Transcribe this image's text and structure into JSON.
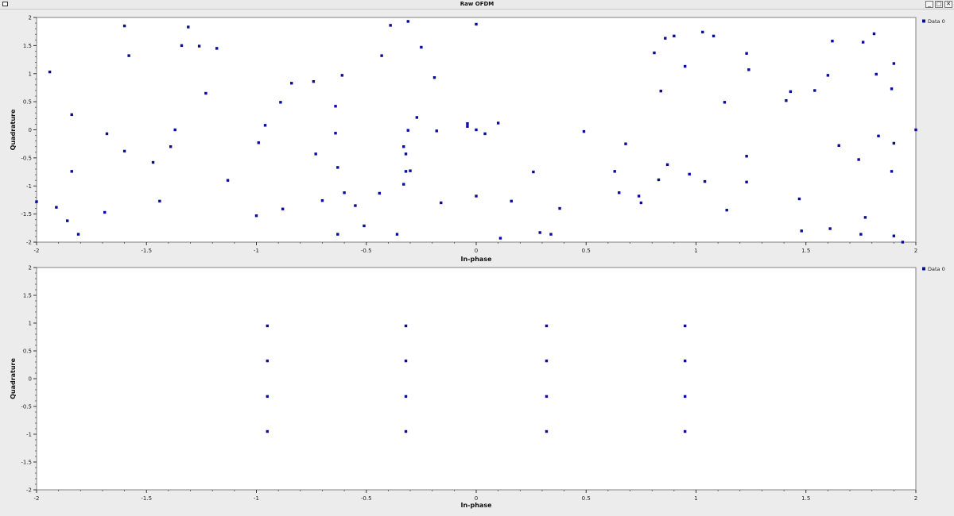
{
  "window": {
    "title": "Raw OFDM",
    "buttons": [
      {
        "name": "minimize-button",
        "glyph": "_"
      },
      {
        "name": "maximize-button",
        "glyph": "□"
      },
      {
        "name": "close-button",
        "glyph": "✕"
      }
    ]
  },
  "colors": {
    "marker": "#0a0a9c",
    "plot_bg": "#ffffff",
    "frame": "#808080"
  },
  "chart_data": [
    {
      "type": "scatter",
      "xlabel": "In-phase",
      "ylabel": "Quadrature",
      "xlim": [
        -2,
        2
      ],
      "ylim": [
        -2,
        2
      ],
      "xticks": [
        "-2",
        "-1.5",
        "-1",
        "-0.5",
        "0",
        "0.5",
        "1",
        "1.5",
        "2"
      ],
      "yticks": [
        "2",
        "1.5",
        "1",
        "0.5",
        "0",
        "-0.5",
        "-1",
        "-1.5",
        "-2"
      ],
      "grid": false,
      "legend": "top-right",
      "series": [
        {
          "name": "Data 0",
          "points": [
            [
              -2.0,
              -1.28
            ],
            [
              -1.94,
              1.03
            ],
            [
              -1.91,
              -1.38
            ],
            [
              -1.86,
              -1.62
            ],
            [
              -1.84,
              0.27
            ],
            [
              -1.84,
              -0.74
            ],
            [
              -1.81,
              -1.86
            ],
            [
              -1.69,
              -1.47
            ],
            [
              -1.68,
              -0.07
            ],
            [
              -1.6,
              1.85
            ],
            [
              -1.6,
              -0.38
            ],
            [
              -1.58,
              1.32
            ],
            [
              -1.47,
              -0.58
            ],
            [
              -1.44,
              -1.27
            ],
            [
              -1.39,
              -0.3
            ],
            [
              -1.37,
              0.0
            ],
            [
              -1.34,
              1.5
            ],
            [
              -1.31,
              1.83
            ],
            [
              -1.26,
              1.49
            ],
            [
              -1.23,
              0.65
            ],
            [
              -1.18,
              1.45
            ],
            [
              -1.13,
              -0.9
            ],
            [
              -1.0,
              -1.53
            ],
            [
              -0.99,
              -0.23
            ],
            [
              -0.96,
              0.08
            ],
            [
              -0.89,
              0.49
            ],
            [
              -0.88,
              -1.41
            ],
            [
              -0.84,
              0.83
            ],
            [
              -0.74,
              0.86
            ],
            [
              -0.73,
              -0.43
            ],
            [
              -0.7,
              -1.26
            ],
            [
              -0.64,
              0.42
            ],
            [
              -0.64,
              -0.06
            ],
            [
              -0.63,
              -0.67
            ],
            [
              -0.63,
              -1.86
            ],
            [
              -0.61,
              0.97
            ],
            [
              -0.6,
              -1.12
            ],
            [
              -0.55,
              -1.35
            ],
            [
              -0.51,
              -1.71
            ],
            [
              -0.44,
              -1.13
            ],
            [
              -0.43,
              1.32
            ],
            [
              -0.39,
              1.86
            ],
            [
              -0.36,
              -1.86
            ],
            [
              -0.33,
              -0.97
            ],
            [
              -0.33,
              -0.3
            ],
            [
              -0.32,
              -0.43
            ],
            [
              -0.32,
              -0.74
            ],
            [
              -0.31,
              1.93
            ],
            [
              -0.31,
              -0.01
            ],
            [
              -0.3,
              -0.73
            ],
            [
              -0.27,
              0.22
            ],
            [
              -0.25,
              1.47
            ],
            [
              -0.19,
              0.93
            ],
            [
              -0.18,
              -0.02
            ],
            [
              -0.16,
              -1.3
            ],
            [
              -0.04,
              0.11
            ],
            [
              -0.04,
              0.06
            ],
            [
              0.0,
              1.88
            ],
            [
              0.0,
              0.0
            ],
            [
              0.0,
              -1.18
            ],
            [
              0.04,
              -0.07
            ],
            [
              0.1,
              0.12
            ],
            [
              0.11,
              -1.93
            ],
            [
              0.16,
              -1.27
            ],
            [
              0.26,
              -0.75
            ],
            [
              0.29,
              -1.83
            ],
            [
              0.34,
              -1.86
            ],
            [
              0.38,
              -1.4
            ],
            [
              0.49,
              -0.03
            ],
            [
              0.63,
              -0.74
            ],
            [
              0.65,
              -1.12
            ],
            [
              0.68,
              -0.25
            ],
            [
              0.74,
              -1.18
            ],
            [
              0.75,
              -1.3
            ],
            [
              0.81,
              1.37
            ],
            [
              0.83,
              -0.89
            ],
            [
              0.84,
              0.69
            ],
            [
              0.86,
              1.63
            ],
            [
              0.87,
              -0.62
            ],
            [
              0.9,
              1.67
            ],
            [
              0.95,
              1.13
            ],
            [
              0.97,
              -0.79
            ],
            [
              1.03,
              1.74
            ],
            [
              1.04,
              -0.92
            ],
            [
              1.08,
              1.67
            ],
            [
              1.13,
              0.49
            ],
            [
              1.14,
              -1.43
            ],
            [
              1.23,
              -0.47
            ],
            [
              1.23,
              -0.93
            ],
            [
              1.23,
              1.36
            ],
            [
              1.24,
              1.07
            ],
            [
              1.41,
              0.52
            ],
            [
              1.43,
              0.68
            ],
            [
              1.47,
              -1.23
            ],
            [
              1.48,
              -1.8
            ],
            [
              1.54,
              0.7
            ],
            [
              1.6,
              0.97
            ],
            [
              1.61,
              -1.76
            ],
            [
              1.62,
              1.58
            ],
            [
              1.65,
              -0.28
            ],
            [
              1.74,
              -0.53
            ],
            [
              1.75,
              -1.86
            ],
            [
              1.76,
              1.56
            ],
            [
              1.77,
              -1.56
            ],
            [
              1.81,
              1.71
            ],
            [
              1.82,
              0.99
            ],
            [
              1.83,
              -0.11
            ],
            [
              1.89,
              0.73
            ],
            [
              1.89,
              -0.74
            ],
            [
              1.9,
              1.18
            ],
            [
              1.9,
              -0.24
            ],
            [
              1.9,
              -1.89
            ],
            [
              1.94,
              -2.0
            ],
            [
              2.0,
              0.0
            ]
          ]
        }
      ]
    },
    {
      "type": "scatter",
      "xlabel": "In-phase",
      "ylabel": "Quadrature",
      "xlim": [
        -2,
        2
      ],
      "ylim": [
        -2,
        2
      ],
      "xticks": [
        "-2",
        "-1.5",
        "-1",
        "-0.5",
        "0",
        "0.5",
        "1",
        "1.5",
        "2"
      ],
      "yticks": [
        "2",
        "1.5",
        "1",
        "0.5",
        "0",
        "-0.5",
        "-1",
        "-1.5",
        "-2"
      ],
      "grid": false,
      "legend": "top-right",
      "series": [
        {
          "name": "Data 0",
          "points": [
            [
              -0.95,
              0.95
            ],
            [
              -0.95,
              0.32
            ],
            [
              -0.95,
              -0.32
            ],
            [
              -0.95,
              -0.95
            ],
            [
              -0.32,
              0.95
            ],
            [
              -0.32,
              0.32
            ],
            [
              -0.32,
              -0.32
            ],
            [
              -0.32,
              -0.95
            ],
            [
              0.32,
              0.95
            ],
            [
              0.32,
              0.32
            ],
            [
              0.32,
              -0.32
            ],
            [
              0.32,
              -0.95
            ],
            [
              0.95,
              0.95
            ],
            [
              0.95,
              0.32
            ],
            [
              0.95,
              -0.32
            ],
            [
              0.95,
              -0.95
            ]
          ]
        }
      ]
    }
  ]
}
